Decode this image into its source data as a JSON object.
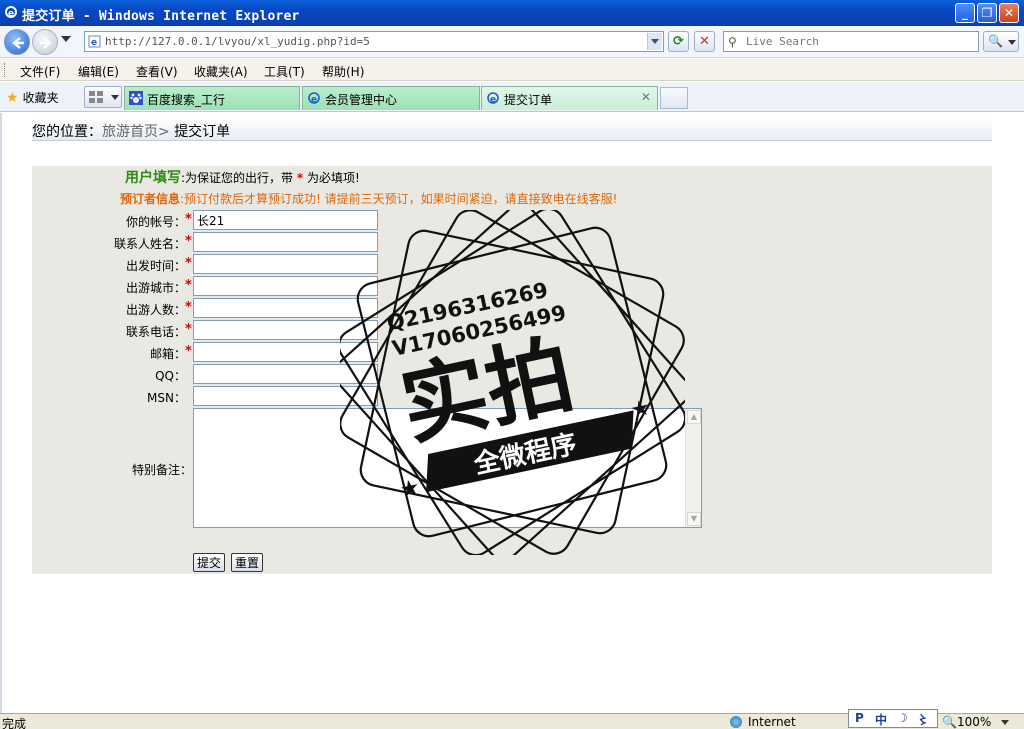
{
  "window": {
    "title": "提交订单 - Windows Internet Explorer",
    "minimize": "_",
    "maximize": "❐",
    "close": "✕"
  },
  "address": {
    "url": "http://127.0.0.1/lvyou/xl_yudig.php?id=5",
    "search_placeholder": "Live Search"
  },
  "menu": [
    "文件(F)",
    "编辑(E)",
    "查看(V)",
    "收藏夹(A)",
    "工具(T)",
    "帮助(H)"
  ],
  "favorites_label": "收藏夹",
  "tabs": [
    {
      "label": "百度搜索_工行"
    },
    {
      "label": "会员管理中心"
    },
    {
      "label": "提交订单"
    }
  ],
  "breadcrumb": {
    "prefix": "您的位置：",
    "home": "旅游首页",
    "sep": ">",
    "current": "提交订单"
  },
  "form": {
    "hint1_strong": "用户填写",
    "hint1_text": ":为保证您的出行，带",
    "hint1_star": "*",
    "hint1_end": "为必填项!",
    "hint2_strong": "预订者信息",
    "hint2_text": ":预订付款后才算预订成功! 请提前三天预订，如果时间紧迫，请直接致电在线客服!",
    "fields": [
      {
        "label": "你的帐号：",
        "required": "*",
        "value": "长21"
      },
      {
        "label": "联系人姓名：",
        "required": "*",
        "value": ""
      },
      {
        "label": "出发时间：",
        "required": "*",
        "value": ""
      },
      {
        "label": "出游城市：",
        "required": "*",
        "value": ""
      },
      {
        "label": "出游人数：",
        "required": "*",
        "value": ""
      },
      {
        "label": "联系电话：",
        "required": "*",
        "value": ""
      },
      {
        "label": "邮箱：",
        "required": "*",
        "value": ""
      },
      {
        "label": "QQ：",
        "required": "",
        "value": ""
      },
      {
        "label": "MSN：",
        "required": "",
        "value": ""
      }
    ],
    "notes_label": "特别备注：",
    "submit": "提交",
    "reset": "重置"
  },
  "watermark": {
    "line1": "Q2196316269",
    "line2": "V17060256499",
    "big": "实拍",
    "banner": "全微程序"
  },
  "status": {
    "text": "完成",
    "zone": "Internet",
    "ime": [
      "P",
      "中",
      "☽",
      "〻"
    ],
    "zoom": "100%"
  }
}
